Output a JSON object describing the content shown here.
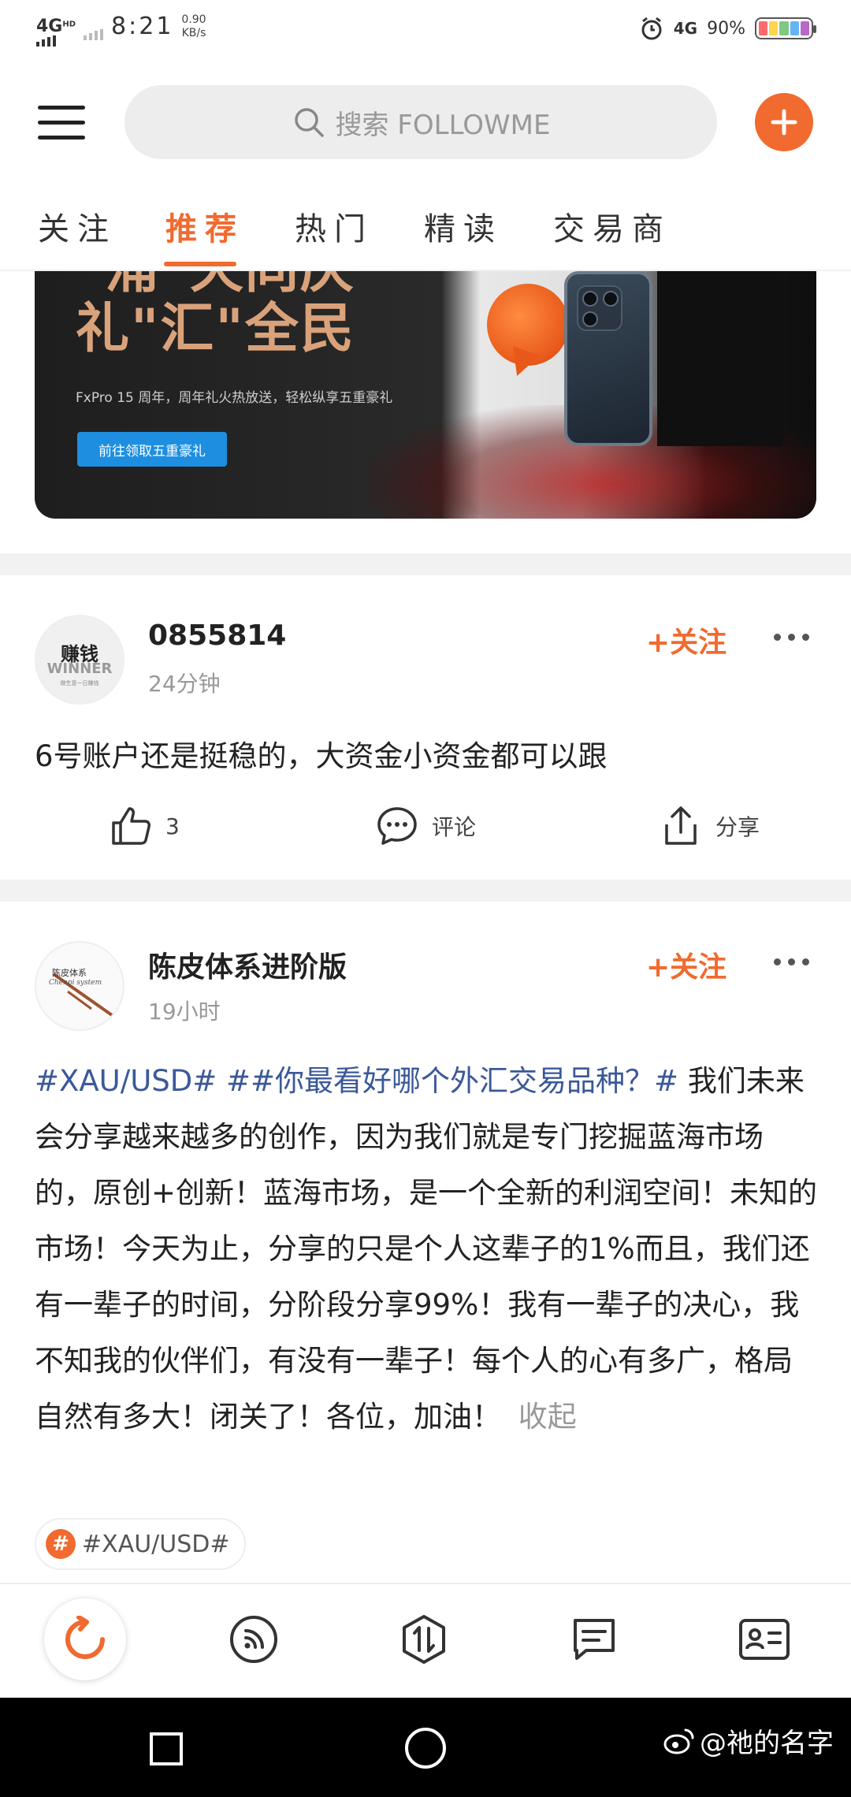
{
  "status_bar": {
    "network": "4G",
    "network_badge": "HD",
    "time": "8:21",
    "speed_value": "0.90",
    "speed_unit": "KB/s",
    "network_right": "4G",
    "battery_text": "90%",
    "battery_colors": [
      "#ff6b6b",
      "#ffd54f",
      "#81c784",
      "#64b5f6",
      "#ba68c8"
    ]
  },
  "header": {
    "search_placeholder": "搜索 FOLLOWME",
    "accent": "#f16a2f"
  },
  "tabs": [
    {
      "label": "关注",
      "active": false
    },
    {
      "label": "推荐",
      "active": true
    },
    {
      "label": "热门",
      "active": false
    },
    {
      "label": "精读",
      "active": false
    },
    {
      "label": "交易商",
      "active": false
    }
  ],
  "banner": {
    "title_line1": "\"浦\"天同庆",
    "title_line2": "礼\"汇\"全民",
    "subtitle": "FxPro 15 周年，周年礼火热放送，轻松纵享五重豪礼",
    "button": "前往领取五重豪礼"
  },
  "posts": [
    {
      "avatar_line1": "赚钱",
      "avatar_line2": "WINNER",
      "avatar_line3": "做生意一日赚钱",
      "author": "0855814",
      "time": "24分钟",
      "follow": "+关注",
      "text": "6号账户还是挺稳的，大资金小资金都可以跟",
      "like_count": "3",
      "comment_label": "评论",
      "share_label": "分享"
    },
    {
      "avatar_line1": "陈皮体系",
      "avatar_line2": "Chenpi system",
      "author": "陈皮体系进阶版",
      "time": "19小时",
      "follow": "+关注",
      "hashtag1": "#XAU/USD#",
      "hashtag2": "##你最看好哪个外汇交易品种？#",
      "text": "我们未来会分享越来越多的创作，因为我们就是专门挖掘蓝海市场的，原创+创新！蓝海市场，是一个全新的利润空间！未知的市场！今天为止，分享的只是个人这辈子的1%而且，我们还有一辈子的时间，分阶段分享99%！我有一辈子的决心，我不知我的伙伴们，有没有一辈子！每个人的心有多广，格局自然有多大！闭关了！各位，加油！",
      "collapse": "收起",
      "tag_chip_symbol": "#",
      "tag_chip": "#XAU/USD#"
    }
  ],
  "bottom_nav": [
    {
      "icon": "refresh-icon"
    },
    {
      "icon": "feed-icon"
    },
    {
      "icon": "trade-icon"
    },
    {
      "icon": "message-icon"
    },
    {
      "icon": "profile-card-icon"
    }
  ],
  "watermark": "@祂的名字"
}
